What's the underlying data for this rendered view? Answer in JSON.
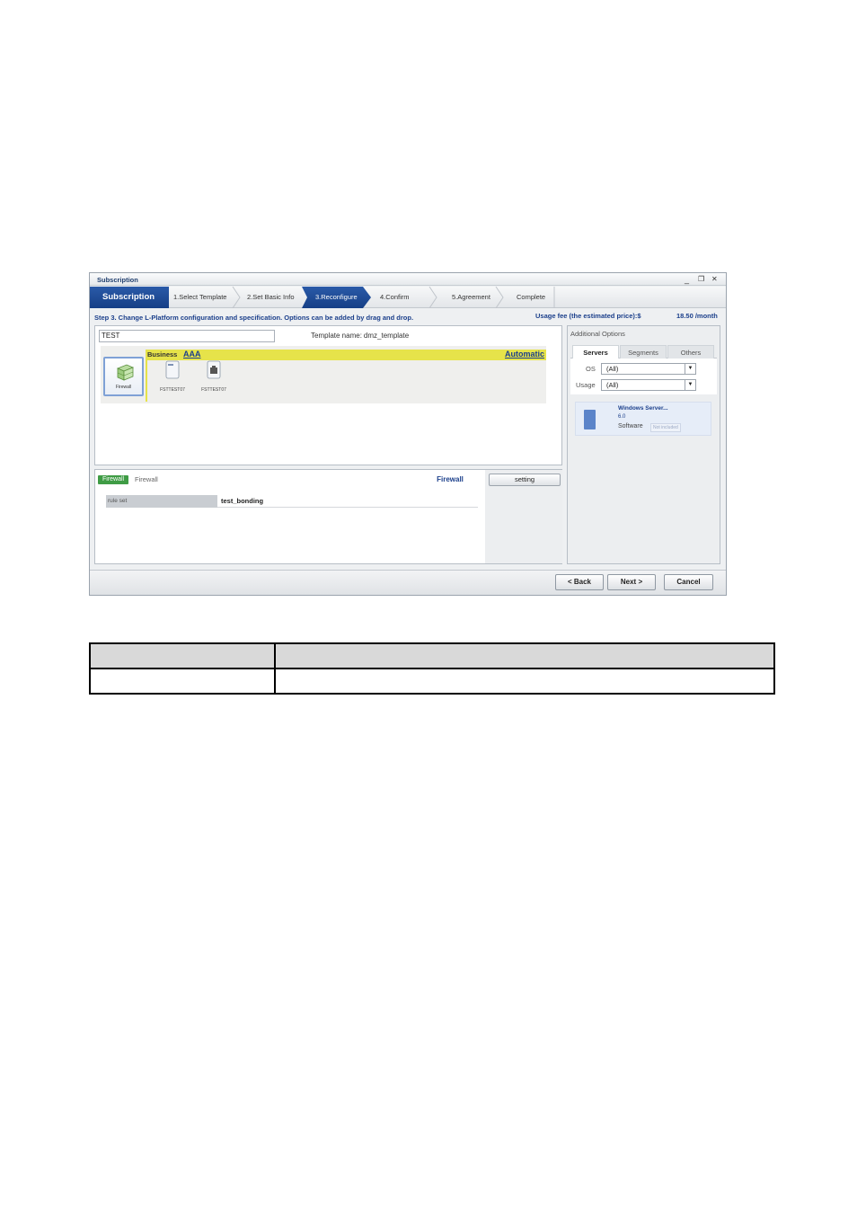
{
  "window": {
    "title": "Subscription",
    "controls": {
      "minimize": "_",
      "restore": "❐",
      "close": "✕"
    }
  },
  "wizard": {
    "title": "Subscription",
    "steps": [
      {
        "label": "1.Select Template",
        "active": false
      },
      {
        "label": "2.Set Basic Info",
        "active": false
      },
      {
        "label": "3.Reconfigure",
        "active": true
      },
      {
        "label": "4.Confirm",
        "active": false
      },
      {
        "label": "5.Agreement",
        "active": false
      },
      {
        "label": "Complete",
        "active": false
      }
    ]
  },
  "step_description": "Step 3. Change L-Platform configuration and specification. Options can be added by drag and drop.",
  "usage_fee": {
    "label": "Usage fee (the estimated price):$",
    "price": "18.50 /month"
  },
  "config": {
    "lplatform_name": "TEST",
    "template_label": "Template name:",
    "template_name": "dmz_template",
    "business": {
      "label": "Business",
      "name": "AAA",
      "mode": "Automatic"
    },
    "firewall_node_label": "Firewall",
    "servers": [
      {
        "label": "FSTTEST07"
      },
      {
        "label": "FSTTEST07"
      }
    ]
  },
  "details": {
    "tag": "Firewall",
    "name": "Firewall",
    "tab": "Firewall",
    "setting_button": "setting",
    "property_key": "rule set",
    "property_value": "test_bonding"
  },
  "additional_options": {
    "title": "Additional Options",
    "tabs": [
      {
        "label": "Servers",
        "active": true
      },
      {
        "label": "Segments",
        "active": false
      },
      {
        "label": "Others",
        "active": false
      }
    ],
    "filters": [
      {
        "label": "OS",
        "value": "(All)"
      },
      {
        "label": "Usage",
        "value": "(All)"
      }
    ],
    "card": {
      "name": "Windows Server...",
      "version": "6.0",
      "software_label": "Software",
      "badge": "Not included"
    }
  },
  "buttons": {
    "back": "< Back",
    "next": "Next >",
    "cancel": "Cancel"
  },
  "colors": {
    "accent": "#1b3f8b",
    "business_bar": "#e6e34a",
    "firewall_tag": "#3f9c45"
  }
}
